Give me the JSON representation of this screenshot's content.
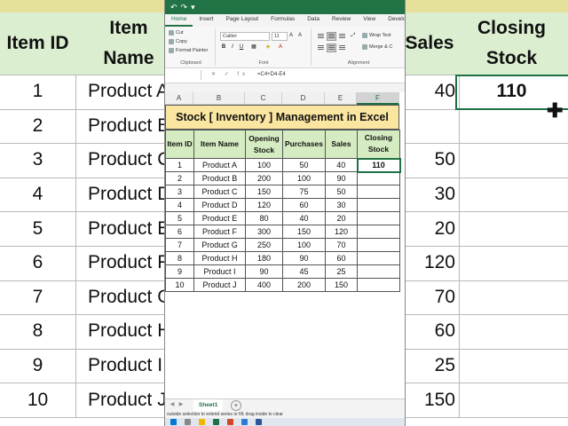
{
  "background_table": {
    "headers": [
      "Item ID",
      "Item Name",
      "Sales",
      "Closing Stock"
    ],
    "rows": [
      {
        "id": "1",
        "name": "Product A",
        "sales": "40",
        "closing": "110"
      },
      {
        "id": "2",
        "name": "Product B",
        "sales": "",
        "closing": ""
      },
      {
        "id": "3",
        "name": "Product C",
        "sales": "50",
        "closing": ""
      },
      {
        "id": "4",
        "name": "Product D",
        "sales": "30",
        "closing": ""
      },
      {
        "id": "5",
        "name": "Product E",
        "sales": "20",
        "closing": ""
      },
      {
        "id": "6",
        "name": "Product F",
        "sales": "120",
        "closing": ""
      },
      {
        "id": "7",
        "name": "Product G",
        "sales": "70",
        "closing": ""
      },
      {
        "id": "8",
        "name": "Product H",
        "sales": "60",
        "closing": ""
      },
      {
        "id": "9",
        "name": "Product I",
        "sales": "25",
        "closing": ""
      },
      {
        "id": "10",
        "name": "Product J",
        "sales": "150",
        "closing": ""
      }
    ]
  },
  "ribbon": {
    "tabs": [
      "Home",
      "Insert",
      "Page Layout",
      "Formulas",
      "Data",
      "Review",
      "View",
      "Developer"
    ],
    "clipboard": {
      "cut": "Cut",
      "copy": "Copy",
      "format_painter": "Format Painter",
      "label": "Clipboard"
    },
    "font": {
      "name": "Calibri",
      "size": "11",
      "bold": "B",
      "italic": "I",
      "underline": "U",
      "label": "Font"
    },
    "alignment": {
      "wrap": "Wrap Text",
      "merge": "Merge & C",
      "label": "Alignment"
    }
  },
  "formula_bar": {
    "fx": "✕ ✓ fx",
    "formula": "=C4+D4-E4"
  },
  "columns": [
    "A",
    "B",
    "C",
    "D",
    "E",
    "F"
  ],
  "sheet": {
    "title": "Stock [ Inventory ] Management in Excel",
    "headers": [
      "Item ID",
      "Item Name",
      "Opening Stock",
      "Purchases",
      "Sales",
      "Closing Stock"
    ],
    "rows": [
      [
        "1",
        "Product A",
        "100",
        "50",
        "40",
        "110"
      ],
      [
        "2",
        "Product B",
        "200",
        "100",
        "90",
        ""
      ],
      [
        "3",
        "Product C",
        "150",
        "75",
        "50",
        ""
      ],
      [
        "4",
        "Product D",
        "120",
        "60",
        "30",
        ""
      ],
      [
        "5",
        "Product E",
        "80",
        "40",
        "20",
        ""
      ],
      [
        "6",
        "Product F",
        "300",
        "150",
        "120",
        ""
      ],
      [
        "7",
        "Product G",
        "250",
        "100",
        "70",
        ""
      ],
      [
        "8",
        "Product H",
        "180",
        "90",
        "60",
        ""
      ],
      [
        "9",
        "Product I",
        "90",
        "45",
        "25",
        ""
      ],
      [
        "10",
        "Product J",
        "400",
        "200",
        "150",
        ""
      ]
    ]
  },
  "sheet_tab": "Sheet1",
  "status_text": "outside selection to extend series or fill; drag inside to clear",
  "colors": {
    "excel_green": "#217346",
    "title_fill": "#fbe6a1",
    "header_fill": "#d5ecc2"
  }
}
